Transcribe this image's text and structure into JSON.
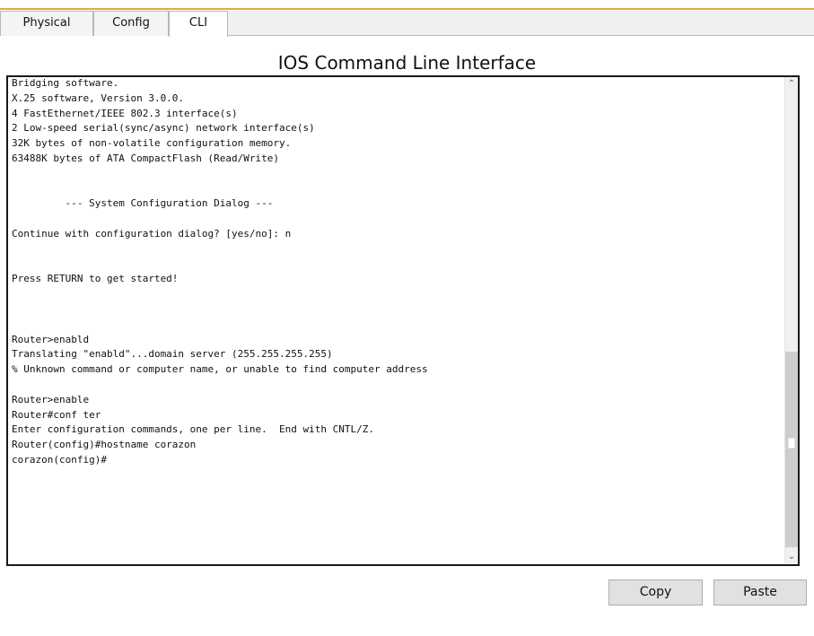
{
  "tabs": [
    {
      "label": "Physical"
    },
    {
      "label": "Config"
    },
    {
      "label": "CLI"
    }
  ],
  "active_tab": "CLI",
  "title": "IOS Command Line Interface",
  "console": {
    "lines": [
      "Bridging software.",
      "X.25 software, Version 3.0.0.",
      "4 FastEthernet/IEEE 802.3 interface(s)",
      "2 Low-speed serial(sync/async) network interface(s)",
      "32K bytes of non-volatile configuration memory.",
      "63488K bytes of ATA CompactFlash (Read/Write)",
      "",
      "",
      "         --- System Configuration Dialog ---",
      "",
      "Continue with configuration dialog? [yes/no]: n",
      "",
      "",
      "Press RETURN to get started!",
      "",
      "",
      "",
      "Router>enabld",
      "Translating \"enabld\"...domain server (255.255.255.255)",
      "% Unknown command or computer name, or unable to find computer address",
      "",
      "Router>enable",
      "Router#conf ter",
      "Enter configuration commands, one per line.  End with CNTL/Z.",
      "Router(config)#hostname corazon",
      "corazon(config)#"
    ],
    "scroll_position_fraction": 0.56
  },
  "icons": {
    "scroll_up": "⌃",
    "scroll_down": "⌄"
  },
  "buttons": {
    "copy_label": "Copy",
    "paste_label": "Paste"
  },
  "colors": {
    "tab_accent": "#e0a84a",
    "console_border": "#1a1a1a",
    "button_bg": "#e1e1e1"
  }
}
